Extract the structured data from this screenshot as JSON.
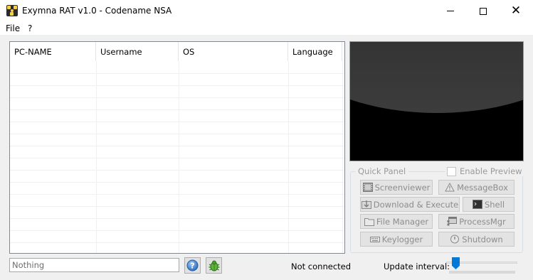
{
  "window": {
    "title": "Exymna RAT v1.0 - Codename NSA"
  },
  "menu": {
    "file": "File",
    "help": "?"
  },
  "client_list": {
    "columns": [
      "PC-NAME",
      "Username",
      "OS",
      "Language"
    ],
    "rows": []
  },
  "quick_panel": {
    "title": "Quick Panel",
    "enable_preview_label": "Enable Preview",
    "enable_preview_checked": false,
    "buttons": {
      "screenviewer": "Screenviewer",
      "messagebox": "MessageBox",
      "download_execute": "Download & Execute",
      "shell": "Shell",
      "file_manager": "File Manager",
      "process_mgr": "ProcessMgr",
      "keylogger": "Keylogger",
      "shutdown": "Shutdown"
    }
  },
  "status_bar": {
    "input_value": "Nothing",
    "connection_status": "Not connected",
    "update_interval_label": "Update interval:"
  },
  "colors": {
    "accent": "#007ad9",
    "disabled_text": "#8d8d8d"
  }
}
